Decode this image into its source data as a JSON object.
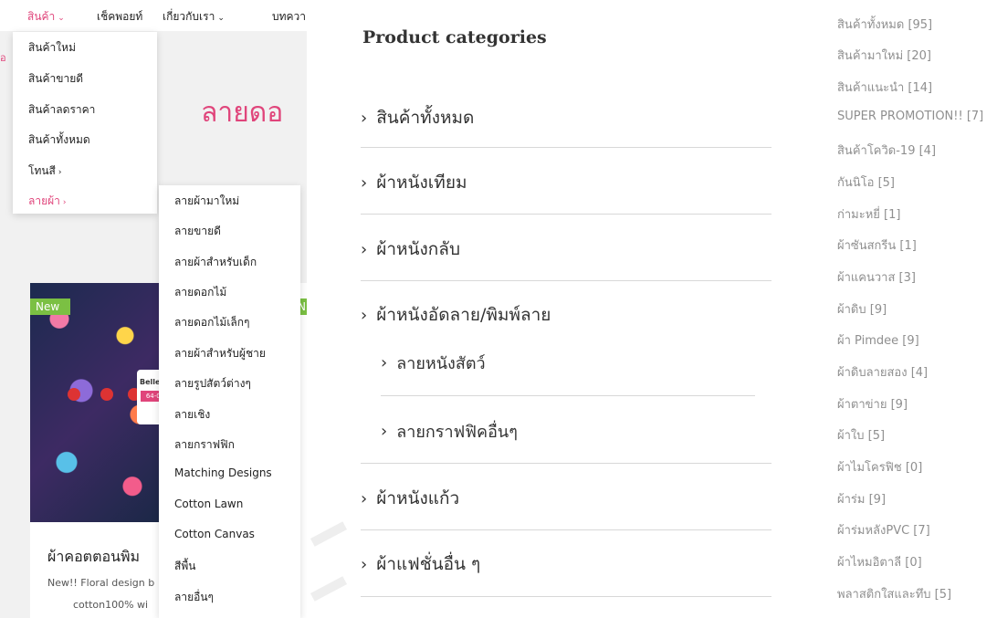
{
  "nav": {
    "items": [
      {
        "label": "สินค้า",
        "chevron": true,
        "active": true
      },
      {
        "label": "เช็คพอยท์",
        "chevron": false,
        "active": false
      },
      {
        "label": "เกี่ยวกับเรา",
        "chevron": true,
        "active": false
      },
      {
        "label": "บทควา",
        "chevron": false,
        "active": false
      }
    ],
    "accent_color": "#e0457b",
    "edge_letter": "อ"
  },
  "dropdown_main": {
    "items": [
      {
        "label": "สินค้าใหม่",
        "has_sub": false,
        "active": false
      },
      {
        "label": "สินค้าขายดี",
        "has_sub": false,
        "active": false
      },
      {
        "label": "สินค้าลดราคา",
        "has_sub": false,
        "active": false
      },
      {
        "label": "สินค้าทั้งหมด",
        "has_sub": false,
        "active": false
      },
      {
        "label": "โทนสี",
        "has_sub": true,
        "active": false
      },
      {
        "label": "ลายผ้า",
        "has_sub": true,
        "active": true
      }
    ]
  },
  "dropdown_sub": {
    "items": [
      "ลายผ้ามาใหม่",
      "ลายขายดี",
      "ลายผ้าสำหรับเด็ก",
      "ลายดอกไม้",
      "ลายดอกไม้เล็กๆ",
      "ลายผ้าสำหรับผู้ชาย",
      "ลายรูปสัตว์ต่างๆ",
      "ลายเชิง",
      "ลายกราฟฟิก",
      "Matching Designs",
      "Cotton Lawn",
      "Cotton Canvas",
      "สีพื้น",
      "ลายอื่นๆ"
    ]
  },
  "hero": {
    "title": "ลายดอ"
  },
  "product": {
    "badge": "New",
    "badge_edge": "N",
    "brand": "Bellebe",
    "code": "64-05",
    "title": "ผ้าคอตตอนพิม",
    "desc_line1": "New!! Floral design b",
    "desc_line2": "cotton100% wi",
    "badge_color": "#7bc043"
  },
  "categories": {
    "heading": "Product categories",
    "items": [
      {
        "label": "สินค้าทั้งหมด",
        "level": 1
      },
      {
        "label": "ผ้าหนังเทียม",
        "level": 1
      },
      {
        "label": "ผ้าหนังกลับ",
        "level": 1
      },
      {
        "label": "ผ้าหนังอัดลาย/พิมพ์ลาย",
        "level": 1
      },
      {
        "label": "ลายหนังสัตว์",
        "level": 2
      },
      {
        "label": "ลายกราฟฟิคอื่นๆ",
        "level": 2
      },
      {
        "label": "ผ้าหนังแก้ว",
        "level": 1
      },
      {
        "label": "ผ้าแฟชั่นอื่น ๆ",
        "level": 1
      }
    ]
  },
  "category_list": {
    "items": [
      "สินค้าทั้งหมด [95]",
      "สินค้ามาใหม่ [20]",
      "สินค้าแนะนำ [14]",
      "SUPER PROMOTION!! [7]",
      "สินค้าโควิด-19 [4]",
      "กันนิโอ [5]",
      "ก่ามะหยี่ [1]",
      "ผ้าซันสกรีน [1]",
      "ผ้าแคนวาส [3]",
      "ผ้าดิบ [9]",
      "ผ้า Pimdee [9]",
      "ผ้าดิบลายสอง [4]",
      "ผ้าตาข่าย [9]",
      "ผ้าใบ [5]",
      "ผ้าไมโครฟิช [0]",
      "ผ้าร่ม [9]",
      "ผ้าร่มหลังPVC [7]",
      "ผ้าไหมอิตาลี [0]",
      "พลาสติกใสและทึบ [5]"
    ]
  }
}
